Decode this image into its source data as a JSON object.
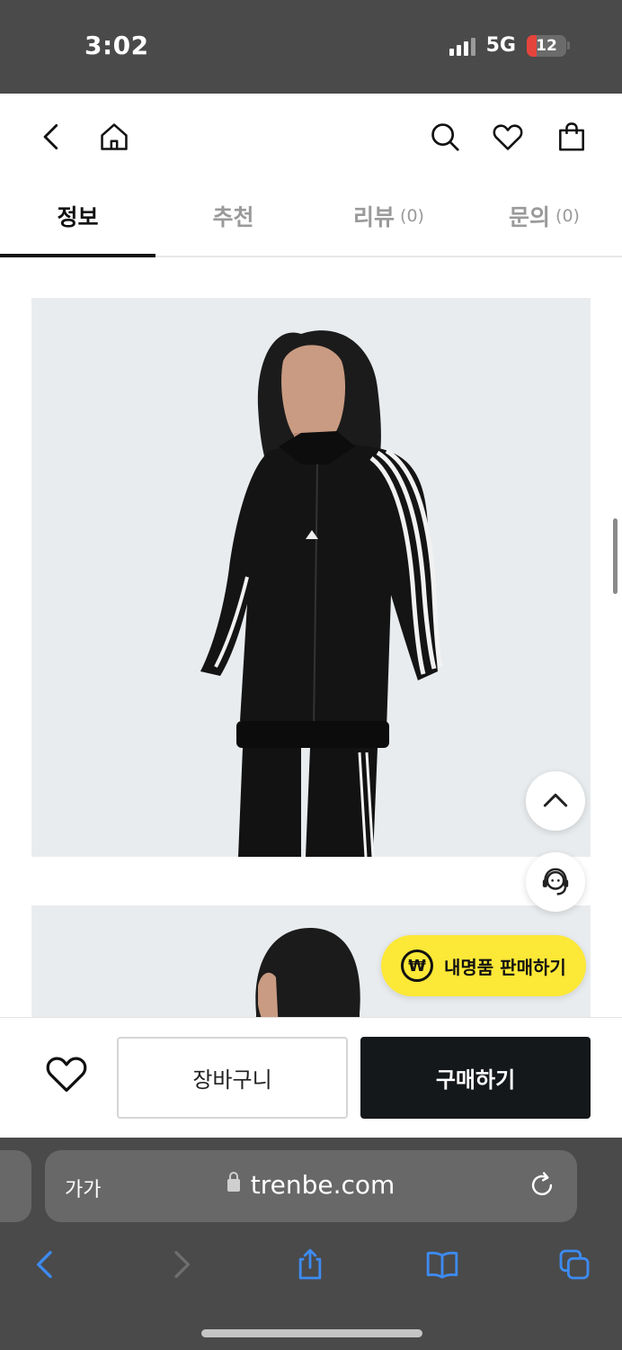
{
  "status_bar": {
    "time": "3:02",
    "network": "5G",
    "battery": "12"
  },
  "tabs": [
    {
      "label": "정보",
      "count": ""
    },
    {
      "label": "추천",
      "count": ""
    },
    {
      "label": "리뷰",
      "count": "(0)"
    },
    {
      "label": "문의",
      "count": "(0)"
    }
  ],
  "floating": {
    "sell_label": "내명품 판매하기",
    "sell_icon": "₩"
  },
  "actions": {
    "cart_label": "장바구니",
    "buy_label": "구매하기"
  },
  "browser": {
    "text_size": "가가",
    "url": "trenbe.com"
  },
  "colors": {
    "sell_yellow": "#fce837",
    "buy_black": "#15181b",
    "image_bg": "#e9ecee"
  }
}
